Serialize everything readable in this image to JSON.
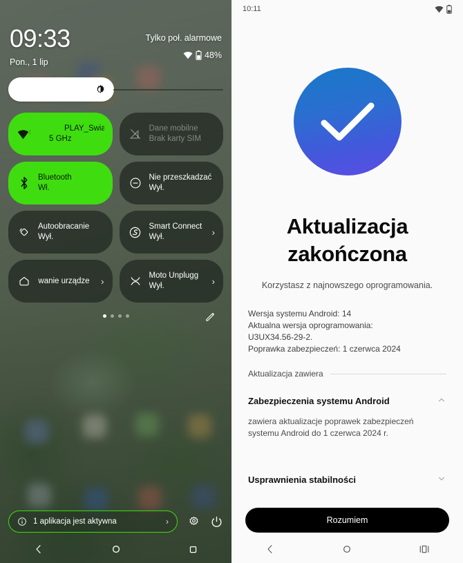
{
  "left_panel": {
    "lock": {
      "time": "09:33",
      "date": "Pon., 1 lip",
      "carrier": "Tylko poł. alarmowe",
      "battery": "48%"
    },
    "brightness": {
      "icon": "brightness-icon",
      "value_pct": 50
    },
    "tiles": [
      {
        "icon": "wifi-icon",
        "title": "PLAY_Swiatl",
        "subtitle": "5 GHz",
        "state": "on",
        "chevron": false
      },
      {
        "icon": "mobile-data-off-icon",
        "title": "Dane mobilne",
        "subtitle": "Brak karty SIM",
        "state": "disabled",
        "chevron": false
      },
      {
        "icon": "bluetooth-icon",
        "title": "Bluetooth",
        "subtitle": "Wł.",
        "state": "on",
        "chevron": false
      },
      {
        "icon": "do-not-disturb-icon",
        "title": "Nie przeszkadzać",
        "subtitle": "Wył.",
        "state": "off",
        "chevron": false
      },
      {
        "icon": "auto-rotate-icon",
        "title": "Autoobracanie",
        "subtitle": "Wył.",
        "state": "off",
        "chevron": false
      },
      {
        "icon": "smart-connect-icon",
        "title": "Smart Connect",
        "subtitle": "Wył.",
        "state": "off",
        "chevron": true
      },
      {
        "icon": "home-icon",
        "title": "owanie urządze",
        "subtitle": "",
        "state": "off",
        "chevron": true
      },
      {
        "icon": "moto-unplugged-icon",
        "title": "Moto Unplugg",
        "subtitle": "Wył.",
        "state": "off",
        "chevron": true
      }
    ],
    "pager": {
      "pages": 4,
      "active_index": 0
    },
    "edit_icon": "pencil-icon",
    "footer": {
      "active_apps_label": "1 aplikacja jest aktywna",
      "info_icon": "info-icon",
      "chevron": "chevron-right-icon",
      "settings_icon": "gear-icon",
      "power_icon": "power-icon"
    },
    "navbar": {
      "back": "back-icon",
      "home": "home-circle-icon",
      "recents": "recents-square-icon"
    }
  },
  "right_panel": {
    "status_bar": {
      "time": "10:11",
      "wifi_icon": "wifi-icon",
      "battery_icon": "battery-icon"
    },
    "hero_icon": "check-circle-icon",
    "title": "Aktualizacja zakończona",
    "subtitle": "Korzystasz z najnowszego oprogramowania.",
    "meta_lines": [
      "Wersja systemu Android: 14",
      "Aktualna wersja oprogramowania:",
      "U3UX34.56-29-2.",
      "Poprawka zabezpieczeń: 1 czerwca 2024"
    ],
    "contains_label": "Aktualizacja zawiera",
    "sections": [
      {
        "title": "Zabezpieczenia systemu Android",
        "expanded": true,
        "chevron": "chevron-up-icon",
        "body": "zawiera aktualizacje poprawek zabezpieczeń systemu Android do 1 czerwca 2024 r."
      },
      {
        "title": "Usprawnienia stabilności",
        "expanded": false,
        "chevron": "chevron-down-icon",
        "body": ""
      }
    ],
    "cta_label": "Rozumiem",
    "navbar": {
      "back": "back-icon",
      "home": "home-circle-icon",
      "recents": "recents-icon"
    }
  },
  "colors": {
    "tile_on": "#3fdd10",
    "tile_off": "rgba(36,44,36,.80)",
    "accent_blue": "#1878c8",
    "accent_purple": "#5b4de4",
    "cta_bg": "#000000"
  }
}
